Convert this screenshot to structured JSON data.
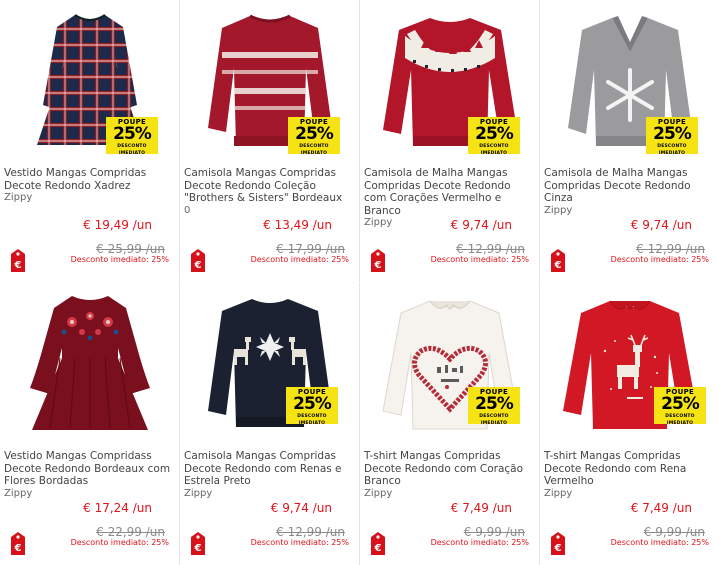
{
  "badge": {
    "line1": "POUPE",
    "line2": "25%",
    "line3": "DESCONTO IMEDIATO"
  },
  "colors": {
    "accent_red": "#e0131a",
    "badge_yellow": "#f6e313"
  },
  "products": [
    {
      "name": "Vestido Mangas Compridas Decote Redondo Xadrez",
      "brand": "Zippy",
      "price": "€ 19,49 /un",
      "old_price": "€ 25,99 /un",
      "discount": "Desconto imediato: 25%",
      "icon": "tartan-dress"
    },
    {
      "name": "Camisola Mangas Compridas Decote Redondo Coleção \"Brothers & Sisters\" Bordeaux",
      "brand": "0",
      "price": "€ 13,49 /un",
      "old_price": "€ 17,99 /un",
      "discount": "Desconto imediato: 25%",
      "icon": "fairisle-sweater"
    },
    {
      "name": "Camisola de Malha Mangas Compridas Decote Redondo com Corações Vermelho e Branco",
      "brand": "Zippy",
      "price": "€ 9,74 /un",
      "old_price": "€ 12,99 /un",
      "discount": "Desconto imediato: 25%",
      "icon": "yoke-sweater"
    },
    {
      "name": "Camisola de Malha Mangas Compridas Decote Redondo Cinza",
      "brand": "Zippy",
      "price": "€ 9,74 /un",
      "old_price": "€ 12,99 /un",
      "discount": "Desconto imediato: 25%",
      "icon": "snowflake-sweater"
    },
    {
      "name": "Vestido Mangas Compridass Decote Redondo Bordeaux com Flores Bordadas",
      "brand": "Zippy",
      "price": "€ 17,24 /un",
      "old_price": "€ 22,99 /un",
      "discount": "Desconto imediato: 25%",
      "icon": "floral-dress"
    },
    {
      "name": "Camisola Mangas Compridas Decote Redondo com Renas e Estrela Preto",
      "brand": "Zippy",
      "price": "€ 9,74 /un",
      "old_price": "€ 12,99 /un",
      "discount": "Desconto imediato: 25%",
      "icon": "reindeer-sweater"
    },
    {
      "name": "T-shirt Mangas Compridas Decote Redondo com Coração Branco",
      "brand": "Zippy",
      "price": "€ 7,49 /un",
      "old_price": "€ 9,99 /un",
      "discount": "Desconto imediato: 25%",
      "icon": "heart-tshirt"
    },
    {
      "name": "T-shirt Mangas Compridas Decote Redondo com Rena Vermelho",
      "brand": "Zippy",
      "price": "€ 7,49 /un",
      "old_price": "€ 9,99 /un",
      "discount": "Desconto imediato: 25%",
      "icon": "reindeer-tshirt"
    }
  ]
}
